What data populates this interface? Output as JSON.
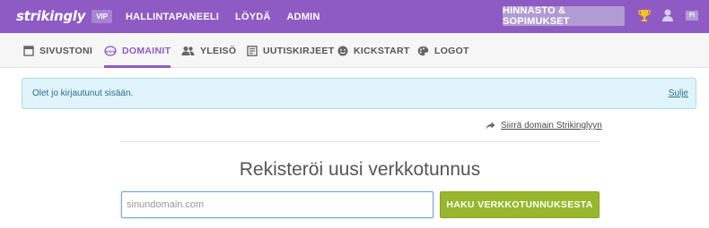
{
  "brand": {
    "logo": "strikingly",
    "badge": "VIP"
  },
  "topnav": {
    "items": [
      "HALLINTAPANEELI",
      "LÖYDÄ",
      "ADMIN"
    ]
  },
  "header": {
    "pricing_button": "HINNASTO & SOPIMUKSET",
    "language": "FI",
    "icons": [
      "trophy-icon",
      "user-icon"
    ]
  },
  "subnav": {
    "items": [
      {
        "label": "SIVUSTONI",
        "icon": "page-icon"
      },
      {
        "label": "DOMAINIT",
        "icon": "www-icon",
        "active": true
      },
      {
        "label": "YLEISÖ",
        "icon": "people-icon"
      },
      {
        "label": "UUTISKIRJEET",
        "icon": "newsletter-icon"
      },
      {
        "label": "KICKSTART",
        "icon": "smile-icon"
      },
      {
        "label": "LOGOT",
        "icon": "palette-icon"
      }
    ]
  },
  "alert": {
    "message": "Olet jo kirjautunut sisään.",
    "close_label": "Sulje"
  },
  "transfer": {
    "label": "Siirrä domain Strikinglyyn"
  },
  "register": {
    "title": "Rekisteröi uusi verkkotunnus",
    "input_placeholder": "sinundomain.com",
    "input_value": "",
    "button_label": "HAKU VERKKOTUNNUKSESTA"
  },
  "colors": {
    "brand": "#8e5bc5",
    "alert_bg": "#dff4fb",
    "button_green": "#98b72d"
  }
}
